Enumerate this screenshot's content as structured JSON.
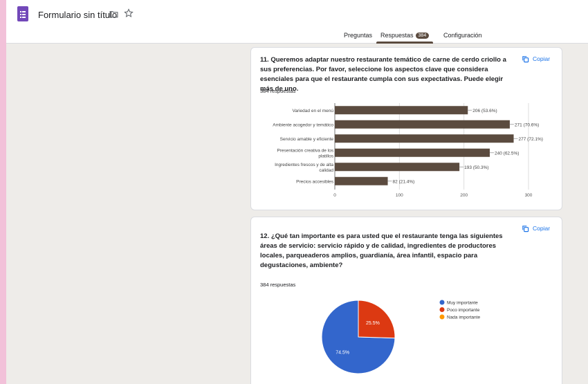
{
  "document": {
    "title": "Formulario sin título"
  },
  "tabs": [
    {
      "label": "Preguntas"
    },
    {
      "label": "Respuestas",
      "badge": "384"
    },
    {
      "label": "Configuración"
    }
  ],
  "questions": [
    {
      "title": "11. Queremos adaptar nuestro restaurante temático de carne de cerdo criollo a sus preferencias. Por favor, seleccione los aspectos clave que considera esenciales para que el restaurante cumpla con sus expectativas. Puede elegir más de uno.",
      "responses": "384 respuestas",
      "copy_label": "Copiar"
    },
    {
      "title": "12. ¿Qué tan importante es para usted que el restaurante tenga las siguientes áreas de servicio: servicio rápido y de calidad, ingredientes de productores locales, parqueaderos amplios, guardianía, área infantil, espacio para degustaciones, ambiente?",
      "responses": "384 respuestas",
      "copy_label": "Copiar"
    }
  ],
  "colors": {
    "bar": "#5b4b3f",
    "accent": "#1a73e8",
    "brand": "#7248b9"
  },
  "chart_data": [
    {
      "type": "bar",
      "orientation": "horizontal",
      "categories": [
        [
          "Variedad en el menú"
        ],
        [
          "Ambiente acogedor y temático"
        ],
        [
          "Servicio amable y eficiente"
        ],
        [
          "Presentación creativa de los",
          "platillos"
        ],
        [
          "Ingredientes frescos y de alta",
          "calidad"
        ],
        [
          "Precios accesibles"
        ]
      ],
      "values": [
        206,
        271,
        277,
        240,
        193,
        82
      ],
      "data_labels": [
        "206 (53.6%)",
        "271 (70.6%)",
        "277 (72.1%)",
        "240 (62.5%)",
        "193 (50.3%)",
        "82 (21.4%)"
      ],
      "xlim": [
        0,
        300
      ],
      "xticks": [
        0,
        100,
        200,
        300
      ],
      "grid": true,
      "color": "#5b4b3f"
    },
    {
      "type": "pie",
      "slices": [
        {
          "label": "Muy importante",
          "value": 74.5,
          "color": "#3366cc",
          "text": "74.5%"
        },
        {
          "label": "Poco importante",
          "value": 25.5,
          "color": "#dc3912",
          "text": "25.5%"
        },
        {
          "label": "Nada importante",
          "value": 0,
          "color": "#ff9900",
          "text": ""
        }
      ],
      "legend": "right"
    }
  ]
}
